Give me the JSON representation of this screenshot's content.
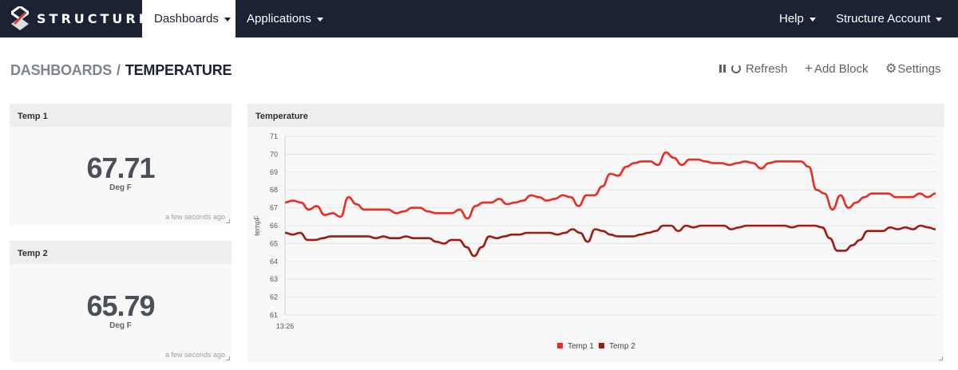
{
  "nav": {
    "brand": "STRUCTURE",
    "dashboards_label": "Dashboards",
    "applications_label": "Applications",
    "help_label": "Help",
    "account_label": "Structure Account"
  },
  "breadcrumb": {
    "root": "DASHBOARDS",
    "separator": "/",
    "current": "TEMPERATURE"
  },
  "toolbar": {
    "refresh_label": "Refresh",
    "add_block_label": "Add Block",
    "settings_label": "Settings"
  },
  "blocks": [
    {
      "title": "Temp 1",
      "value": "67.71",
      "unit": "Deg F",
      "updated": "a few seconds ago"
    },
    {
      "title": "Temp 2",
      "value": "65.79",
      "unit": "Deg F",
      "updated": "a few seconds ago"
    }
  ],
  "colors": {
    "nav_bg": "#1b2233",
    "temp1": "#ee2a24",
    "temp2": "#a11a10"
  },
  "chart_panel": {
    "title": "Temperature"
  },
  "chart_data": {
    "type": "line",
    "title": "Temperature",
    "ylabel": "tempF",
    "xlabel": "",
    "ylim": [
      61,
      71
    ],
    "yticks": [
      61,
      62,
      63,
      64,
      65,
      66,
      67,
      68,
      69,
      70,
      71
    ],
    "xtick_label": "13:26",
    "grid": true,
    "legend": "bottom-center",
    "series": [
      {
        "name": "Temp 1",
        "color": "#ee2a24",
        "values": [
          67.3,
          67.4,
          67.3,
          66.9,
          67.1,
          66.6,
          66.7,
          66.5,
          67.6,
          67.2,
          66.9,
          66.9,
          66.9,
          66.9,
          66.7,
          66.8,
          67.0,
          67.0,
          66.8,
          66.7,
          66.7,
          66.7,
          66.9,
          66.4,
          67.1,
          67.3,
          67.3,
          67.5,
          67.2,
          67.3,
          67.4,
          67.7,
          67.6,
          67.4,
          67.5,
          67.7,
          67.6,
          67.1,
          67.7,
          67.7,
          68.2,
          68.9,
          68.8,
          69.3,
          69.5,
          69.6,
          69.6,
          69.4,
          70.1,
          69.8,
          69.4,
          69.7,
          69.7,
          69.6,
          69.5,
          69.5,
          69.4,
          69.5,
          69.6,
          69.5,
          69.2,
          69.5,
          69.6,
          69.6,
          69.6,
          69.6,
          69.3,
          68.0,
          67.8,
          66.9,
          67.7,
          67.0,
          67.3,
          67.6,
          67.8,
          67.8,
          67.8,
          67.6,
          67.6,
          67.6,
          67.8,
          67.6,
          67.8
        ]
      },
      {
        "name": "Temp 2",
        "color": "#a11a10",
        "values": [
          65.6,
          65.5,
          65.6,
          65.2,
          65.2,
          65.3,
          65.4,
          65.4,
          65.4,
          65.4,
          65.4,
          65.4,
          65.3,
          65.4,
          65.3,
          65.3,
          65.4,
          65.3,
          65.3,
          65.3,
          65.1,
          65.0,
          65.2,
          65.2,
          64.8,
          64.3,
          64.8,
          65.4,
          65.3,
          65.4,
          65.5,
          65.5,
          65.6,
          65.6,
          65.6,
          65.6,
          65.5,
          65.6,
          65.8,
          65.6,
          65.1,
          65.8,
          65.7,
          65.5,
          65.4,
          65.4,
          65.4,
          65.5,
          65.6,
          65.7,
          66.0,
          66.0,
          65.7,
          66.0,
          65.9,
          66.0,
          66.0,
          66.0,
          66.0,
          65.8,
          65.9,
          66.0,
          66.0,
          66.0,
          66.0,
          66.0,
          66.0,
          65.9,
          66.0,
          66.0,
          66.0,
          65.9,
          65.3,
          64.6,
          64.6,
          64.9,
          65.2,
          65.7,
          65.7,
          65.7,
          65.9,
          65.8,
          65.9,
          65.8,
          66.0,
          65.9,
          65.8
        ]
      }
    ]
  }
}
